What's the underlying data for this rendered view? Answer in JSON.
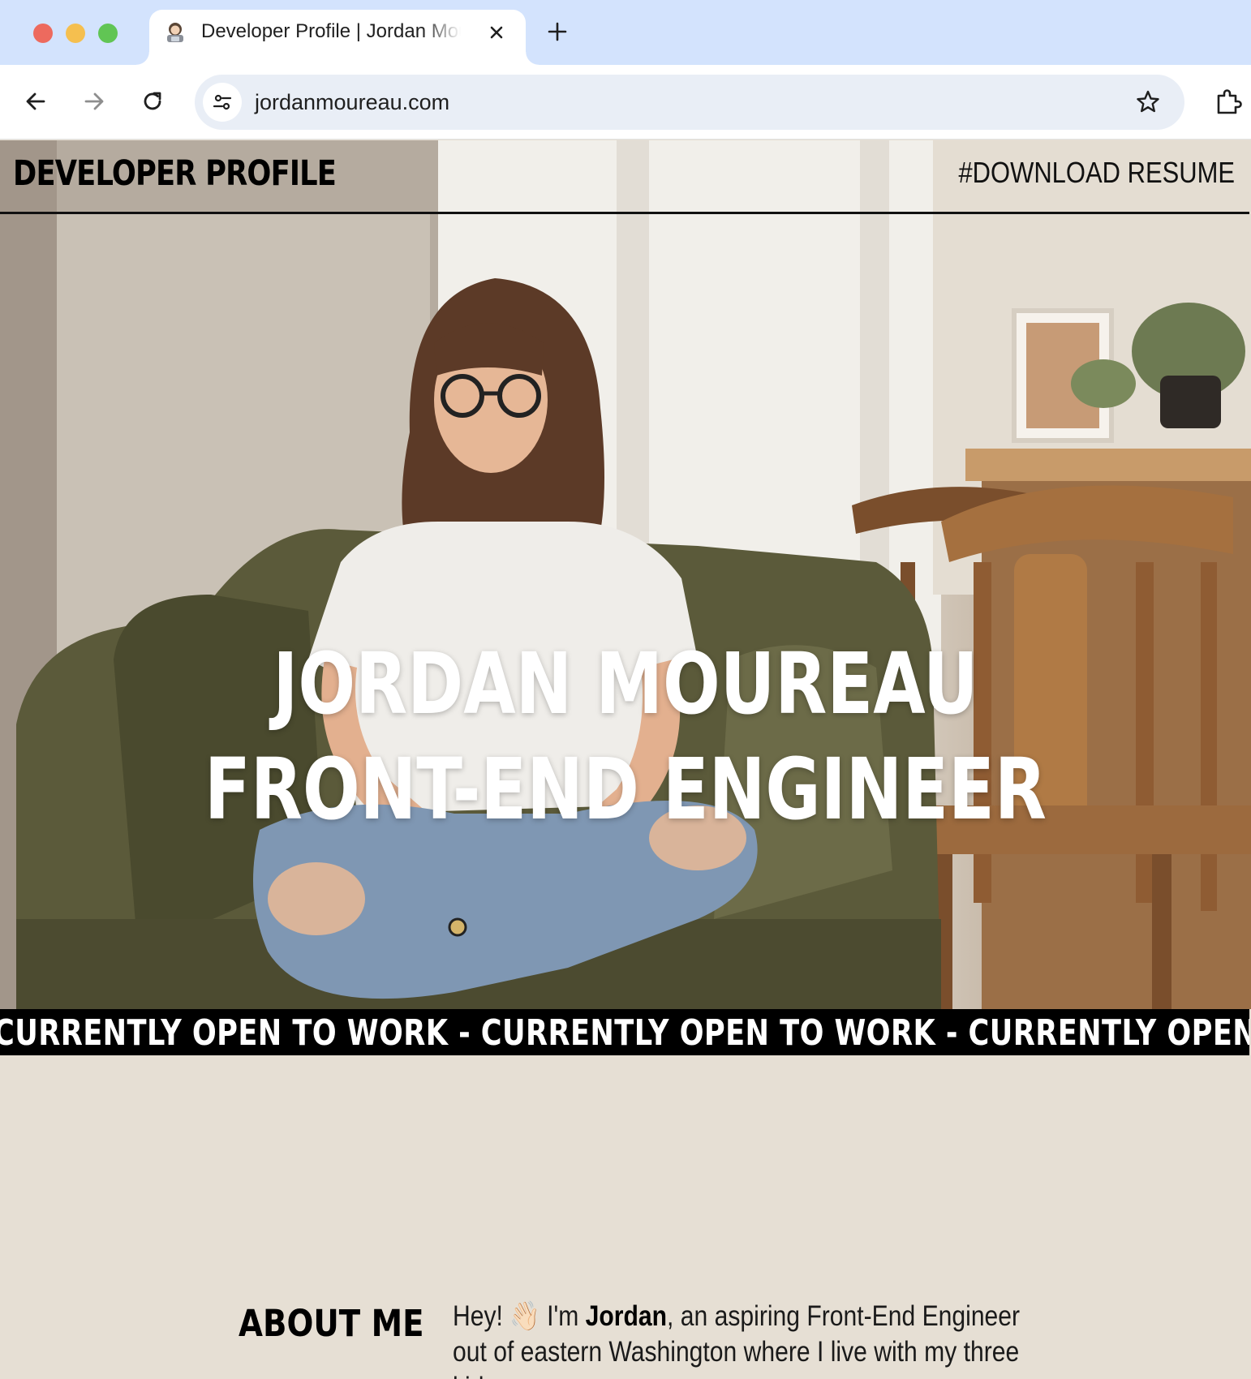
{
  "browser": {
    "tab_title": "Developer Profile | Jordan Moureau",
    "url": "jordanmoureau.com"
  },
  "header": {
    "brand": "DEVELOPER PROFILE",
    "resume_link": "#DOWNLOAD RESUME"
  },
  "hero": {
    "name": "JORDAN MOUREAU",
    "role": "FRONT-END ENGINEER"
  },
  "ticker": {
    "text": "CURRENTLY OPEN TO WORK - CURRENTLY OPEN TO WORK - CURRENTLY OPEN TO WORK"
  },
  "about": {
    "heading": "ABOUT ME",
    "intro_before": "Hey! ",
    "wave_emoji": "👋🏻",
    "intro_im": " I'm ",
    "name": "Jordan",
    "intro_after": ", an aspiring Front-End Engineer out of eastern Washington where I live with my three kids"
  },
  "colors": {
    "page_background": "#e6dfd4",
    "tabstrip": "#d3e3fd",
    "omnibox": "#e9eef6",
    "ticker_background": "#000000",
    "hero_text": "#ffffff"
  },
  "icons": [
    "technologist-favicon-icon",
    "close-icon",
    "plus-icon",
    "back-arrow-icon",
    "forward-arrow-icon",
    "reload-icon",
    "site-settings-icon",
    "bookmark-star-icon",
    "extensions-icon"
  ]
}
